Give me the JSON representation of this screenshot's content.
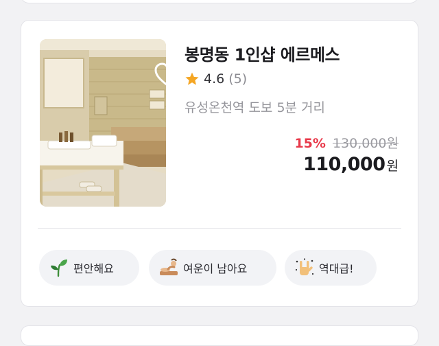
{
  "listing": {
    "title": "봉명동 1인샵 에르메스",
    "rating": {
      "score": "4.6",
      "count": "(5)"
    },
    "location": "유성온천역 도보 5분 거리",
    "price": {
      "discount": "15%",
      "original": "130,000원",
      "final": "110,000",
      "currency": "원"
    },
    "tags": [
      {
        "label": "편안해요",
        "icon": "sprout-icon"
      },
      {
        "label": "여운이 남아요",
        "icon": "massage-icon"
      },
      {
        "label": "역대급!",
        "icon": "rock-hand-icon"
      }
    ]
  },
  "colors": {
    "discount": "#e8394a",
    "star": "#f5a623",
    "tag_background": "#f2f3f6",
    "card_border": "#e3e3e8"
  }
}
